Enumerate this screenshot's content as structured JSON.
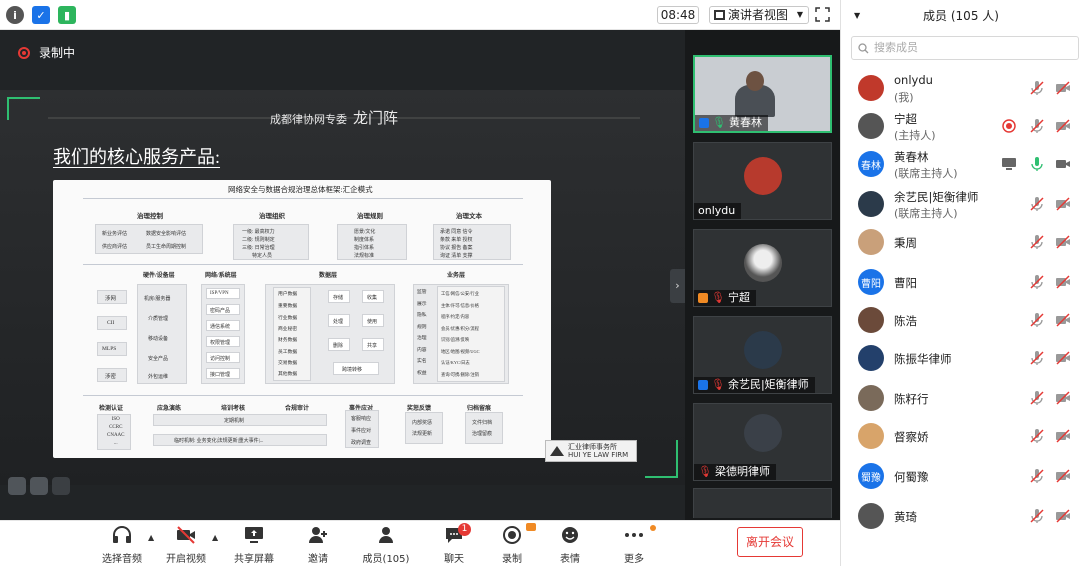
{
  "top": {
    "time": "08:48",
    "view_mode": "演讲者视图"
  },
  "stage": {
    "recording": "录制中",
    "slide": {
      "header_small": "成都律协网专委",
      "header_big": "龙门阵",
      "title": "我们的核心服务产品:",
      "framework": {
        "title": "网络安全与数据合规治理总体框架:汇企模式",
        "top": [
          {
            "head": "治理控制",
            "cells": [
              "新业务评估",
              "数据安全影响评估",
              "供应商评估",
              "员工生命周期控制"
            ]
          },
          {
            "head": "治理组织",
            "lines": [
              "一级: 最高权力",
              "二级: 规则制定",
              "三级: 日常治理",
              "特定人员"
            ]
          },
          {
            "head": "治理规则",
            "lines": [
              "愿景/文化",
              "制度体系",
              "指引体系",
              "法规标准"
            ]
          },
          {
            "head": "治理文本",
            "lines": [
              "承诺  同意  信令",
              "条款  来单  授权",
              "协议  报告  备案",
              "询证  清单  支撑"
            ]
          }
        ],
        "mid": [
          {
            "head": "硬件/设备层",
            "left": [
              "涉网",
              "CII",
              "MLPS",
              "涉密"
            ],
            "right": [
              "机房/服务器",
              "介质管理",
              "移动设备",
              "安全产品",
              "外包运维"
            ]
          },
          {
            "head": "网络/系统层",
            "items": [
              "ISP/VPN",
              "密码产品",
              "通信系统",
              "权限管理",
              "访问控制",
              "接口管理"
            ]
          },
          {
            "head": "数据层",
            "left": [
              "用户数据",
              "重要数据",
              "行业数据",
              "商业秘密",
              "财务数据",
              "员工数据",
              "交易数据",
              "其他数据"
            ],
            "right": [
              "存储",
              "收集",
              "处理",
              "使用",
              "删除",
              "共享",
              "跨境转移"
            ]
          },
          {
            "head": "业务层",
            "left": [
              "监管",
              "展示",
              "隐私",
              "规则",
              "治理",
              "内容",
              "实名",
              "权益"
            ],
            "right": [
              "工信/网信/公安/行业",
              "主体/许可/信息/价格",
              "程序/约定/内容",
              "会员/优惠/积分/流程",
              "识别/追溯/反映",
              "地区/地图/视频/UGC",
              "认证/KYC/日志",
              "查询/可携/删除/注销"
            ]
          }
        ],
        "bottom": [
          {
            "head": "检测认证",
            "lines": [
              "ISO",
              "CCRC",
              "CNAAC",
              "..."
            ]
          },
          {
            "head": "应急演练",
            "lines": [
              "定期机制",
              "临时机制: 业务变化|法规更新|重大事件|..."
            ]
          },
          {
            "head": "培训考核",
            "lines": []
          },
          {
            "head": "合规审计",
            "lines": []
          },
          {
            "head": "事件应对",
            "lines": [
              "客服响应",
              "事件应对",
              "政府调查"
            ]
          },
          {
            "head": "奖惩反馈",
            "lines": [
              "内部奖惩",
              "法规更新"
            ]
          },
          {
            "head": "归档留痕",
            "lines": [
              "文件归档",
              "治理留痕"
            ]
          }
        ]
      },
      "logo": "汇业律师事务所\nHUI YE LAW FIRM"
    }
  },
  "thumbs": [
    {
      "name": "黄春林",
      "mic": "on"
    },
    {
      "name": "onlydu",
      "mic": "none"
    },
    {
      "name": "宁超",
      "mic": "muted"
    },
    {
      "name": "余艺民|矩衡律师",
      "mic": "muted"
    },
    {
      "name": "梁德明律师",
      "mic": "muted"
    }
  ],
  "toolbar": {
    "audio": "选择音频",
    "video": "开启视频",
    "share": "共享屏幕",
    "invite": "邀请",
    "members": "成员(105)",
    "chat": "聊天",
    "chat_badge": "1",
    "record": "录制",
    "emoji": "表情",
    "more": "更多",
    "leave": "离开会议"
  },
  "sidebar": {
    "title": "成员 (105 人)",
    "search_placeholder": "搜索成员",
    "members": [
      {
        "name": "onlydu",
        "role": "(我)",
        "avatar_text": "",
        "color": "#c0392b"
      },
      {
        "name": "宁超",
        "role": "(主持人)",
        "avatar_text": "",
        "color": "#555"
      },
      {
        "name": "黄春林",
        "role": "(联席主持人)",
        "avatar_text": "春林",
        "color": "#1a73e8"
      },
      {
        "name": "余艺民|矩衡律师",
        "role": "(联席主持人)",
        "avatar_text": "",
        "color": "#2b3a4a"
      },
      {
        "name": "秉周",
        "role": "",
        "avatar_text": "",
        "color": "#c9a07a"
      },
      {
        "name": "曹阳",
        "role": "",
        "avatar_text": "曹阳",
        "color": "#1a73e8"
      },
      {
        "name": "陈浩",
        "role": "",
        "avatar_text": "",
        "color": "#6b4a3a"
      },
      {
        "name": "陈振华律师",
        "role": "",
        "avatar_text": "",
        "color": "#23406b"
      },
      {
        "name": "陈籽行",
        "role": "",
        "avatar_text": "",
        "color": "#7a6a5a"
      },
      {
        "name": "督察娇",
        "role": "",
        "avatar_text": "",
        "color": "#d8a46a"
      },
      {
        "name": "何蜀豫",
        "role": "",
        "avatar_text": "蜀豫",
        "color": "#1a73e8"
      },
      {
        "name": "黄琦",
        "role": "",
        "avatar_text": "",
        "color": "#555"
      }
    ]
  }
}
